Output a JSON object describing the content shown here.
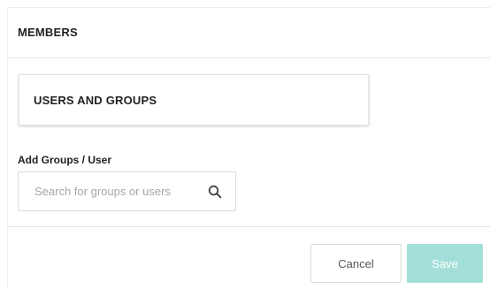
{
  "panel": {
    "title": "MEMBERS"
  },
  "tab_card": {
    "label": "USERS AND GROUPS"
  },
  "add_members": {
    "label": "Add Groups / User",
    "search": {
      "value": "",
      "placeholder": "Search for groups or users",
      "icon": "search-icon"
    }
  },
  "footer": {
    "cancel_label": "Cancel",
    "save_label": "Save",
    "save_enabled": false
  },
  "colors": {
    "save_button_disabled": "#a3dfd8",
    "border": "#e3e3e3",
    "text": "#222222",
    "placeholder": "#a6a6a6"
  }
}
